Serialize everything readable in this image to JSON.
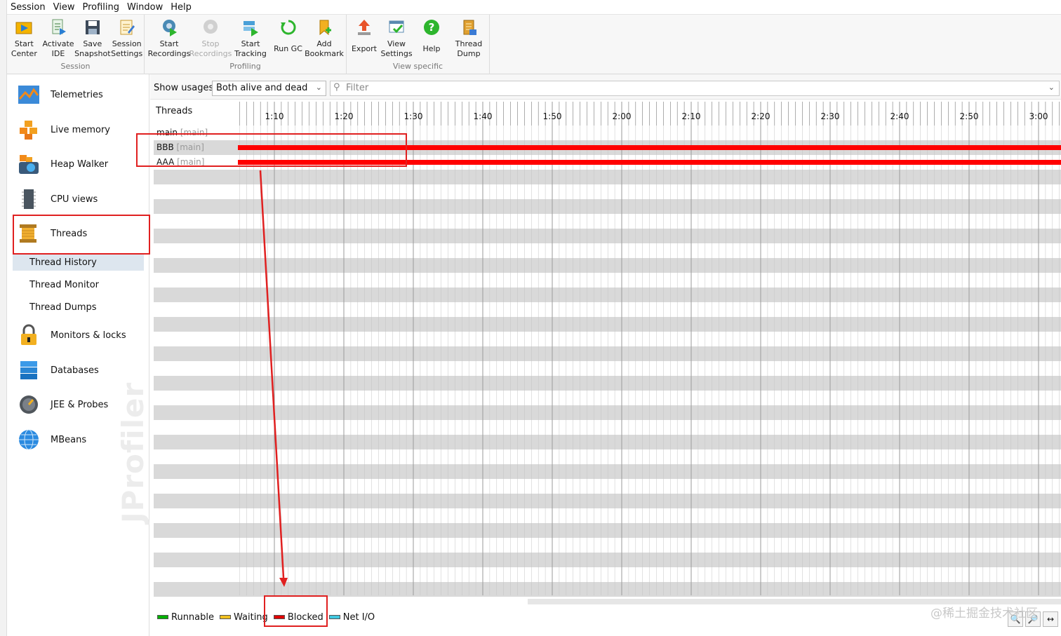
{
  "menu": [
    "Session",
    "View",
    "Profiling",
    "Window",
    "Help"
  ],
  "toolbar": {
    "groups": [
      {
        "caption": "Session",
        "buttons": [
          {
            "line1": "Start",
            "line2": "Center",
            "icon": "start-center-icon"
          },
          {
            "line1": "Activate",
            "line2": "IDE",
            "icon": "activate-ide-icon"
          },
          {
            "line1": "Save",
            "line2": "Snapshot",
            "icon": "save-snapshot-icon"
          },
          {
            "line1": "Session",
            "line2": "Settings",
            "icon": "session-settings-icon"
          }
        ]
      },
      {
        "caption": "Profiling",
        "buttons": [
          {
            "line1": "Start",
            "line2": "Recordings",
            "icon": "start-recordings-icon"
          },
          {
            "line1": "Stop",
            "line2": "Recordings",
            "icon": "stop-recordings-icon",
            "disabled": true
          },
          {
            "line1": "Start",
            "line2": "Tracking",
            "icon": "start-tracking-icon"
          },
          {
            "line1": "Run GC",
            "line2": "",
            "icon": "run-gc-icon"
          },
          {
            "line1": "Add",
            "line2": "Bookmark",
            "icon": "add-bookmark-icon"
          }
        ]
      },
      {
        "caption": "View specific",
        "buttons": [
          {
            "line1": "Export",
            "line2": "",
            "icon": "export-icon"
          },
          {
            "line1": "View",
            "line2": "Settings",
            "icon": "view-settings-icon"
          },
          {
            "line1": "Help",
            "line2": "",
            "icon": "help-icon"
          },
          {
            "line1": "Thread",
            "line2": "Dump",
            "icon": "thread-dump-icon"
          }
        ]
      }
    ]
  },
  "sidebar": {
    "items": [
      {
        "label": "Telemetries",
        "icon": "telemetries-icon"
      },
      {
        "label": "Live memory",
        "icon": "live-memory-icon"
      },
      {
        "label": "Heap Walker",
        "icon": "heap-walker-icon"
      },
      {
        "label": "CPU views",
        "icon": "cpu-views-icon"
      },
      {
        "label": "Threads",
        "icon": "threads-icon"
      },
      {
        "label": "Monitors & locks",
        "icon": "monitors-locks-icon"
      },
      {
        "label": "Databases",
        "icon": "databases-icon"
      },
      {
        "label": "JEE & Probes",
        "icon": "jee-probes-icon"
      },
      {
        "label": "MBeans",
        "icon": "mbeans-icon"
      }
    ],
    "sub_items": [
      "Thread History",
      "Thread Monitor",
      "Thread Dumps"
    ],
    "watermark": "JProfiler"
  },
  "filterbar": {
    "show_label": "Show usages:",
    "usage_value": "Both alive and dead",
    "filter_placeholder": "Filter"
  },
  "timeline": {
    "header": "Threads",
    "ticks": [
      "1:10",
      "1:20",
      "1:30",
      "1:40",
      "1:50",
      "2:00",
      "2:10",
      "2:20",
      "2:30",
      "2:40",
      "2:50",
      "3:00"
    ],
    "threads": [
      {
        "name": "main",
        "group": "[main]",
        "state": "none"
      },
      {
        "name": "BBB",
        "group": "[main]",
        "state": "blocked"
      },
      {
        "name": "AAA",
        "group": "[main]",
        "state": "blocked"
      }
    ]
  },
  "legend": [
    {
      "label": "Runnable",
      "color": "#00b000"
    },
    {
      "label": "Waiting",
      "color": "#f0c020"
    },
    {
      "label": "Blocked",
      "color": "#e00000"
    },
    {
      "label": "Net I/O",
      "color": "#40c8e0"
    }
  ],
  "colors": {
    "annotation": "#e02020",
    "blocked": "#ff0000",
    "stripe": "#d9d9d9"
  },
  "credit": "@稀土掘金技术社区"
}
